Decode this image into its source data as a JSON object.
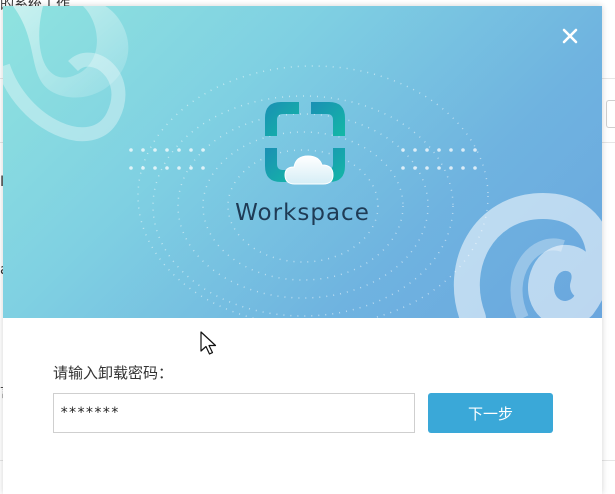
{
  "background_app": {
    "top_text": "的系统工作",
    "left_chars": [
      "I",
      "a",
      "言"
    ]
  },
  "dialog": {
    "close_icon": "close-icon",
    "logo_icon": "workspace-logo-icon",
    "brand_name": "Workspace",
    "password_label": "请输入卸载密码：",
    "password_value": "*******",
    "next_button_label": "下一步",
    "colors": {
      "accent": "#3aa8d8",
      "banner_start": "#8fe3df",
      "banner_end": "#6aa6de",
      "brand_text": "#1f3b55"
    }
  }
}
